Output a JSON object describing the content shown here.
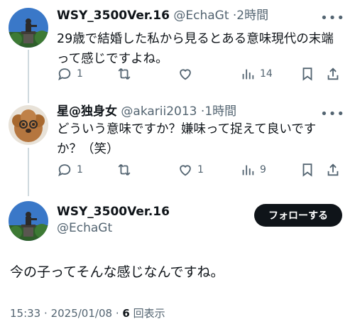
{
  "tweets": [
    {
      "name": "WSY_3500Ver.16",
      "handle": "@EchaGt",
      "time": "2時間",
      "text_lines": [
        "29歳で結婚した私から見るとある意味現代の末端",
        "って感じですよね。"
      ],
      "replies": "1",
      "retweets": "",
      "likes": "",
      "views": "14"
    },
    {
      "name": "星@独身女",
      "handle": "@akarii2013",
      "time": "1時間",
      "text_lines": [
        "どういう意味ですか？嫌味って捉えて良いです",
        "か？（笑）"
      ],
      "replies": "1",
      "retweets": "",
      "likes": "1",
      "views": "9"
    }
  ],
  "main_tweet": {
    "name": "WSY_3500Ver.16",
    "handle": "@EchaGt",
    "follow_label": "フォローする",
    "text": "今の子ってそんな感じなんですね。",
    "time": "15:33",
    "date": "2025/01/08",
    "views": "6",
    "views_label": "回表示"
  },
  "separator": "·",
  "colors": {
    "text": "#0f1419",
    "secondary": "#536471",
    "line": "#cfd9de",
    "button": "#0f1419"
  },
  "icons": [
    "reply-icon",
    "retweet-icon",
    "like-icon",
    "views-icon",
    "bookmark-icon",
    "share-icon",
    "more-icon"
  ]
}
